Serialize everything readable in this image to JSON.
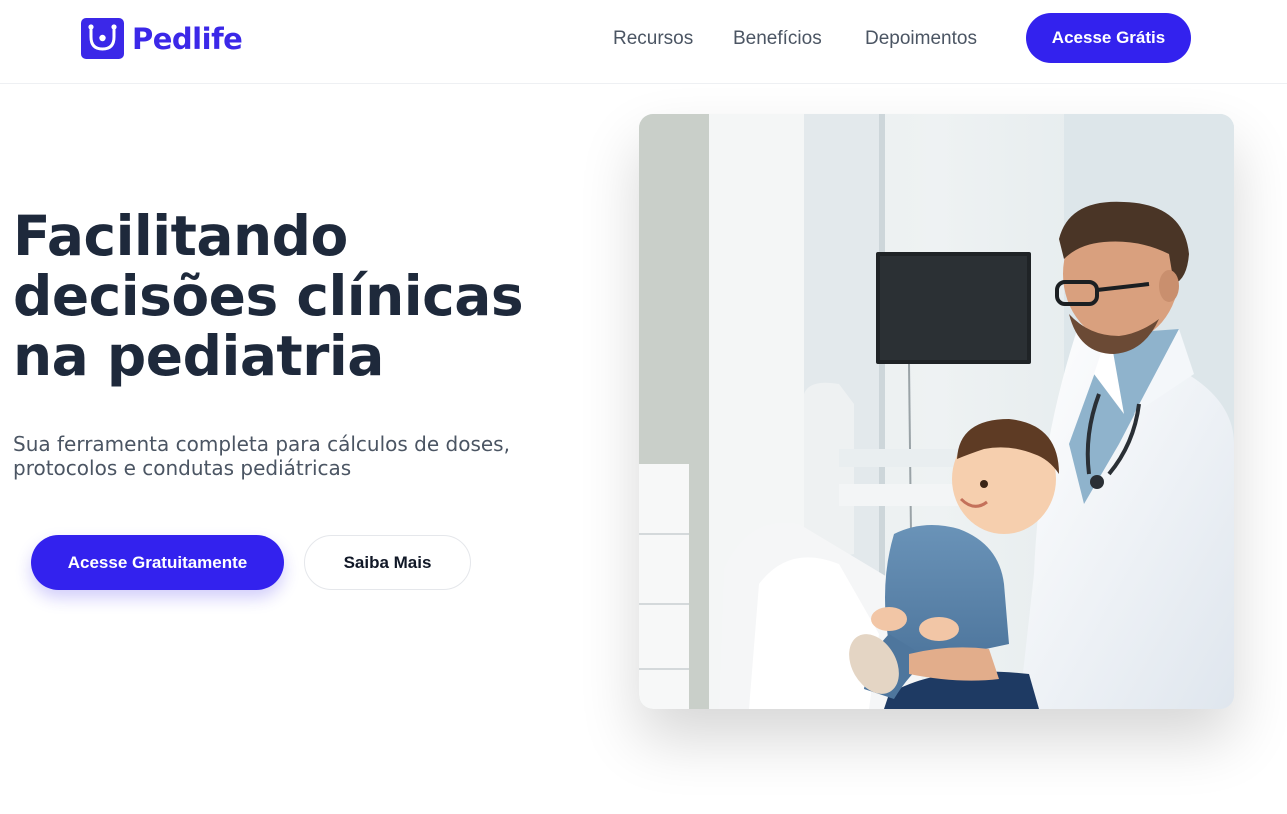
{
  "brand": {
    "name": "Pedlife",
    "color": "#3b28e8"
  },
  "nav": {
    "links": [
      "Recursos",
      "Benefícios",
      "Depoimentos"
    ],
    "cta": "Acesse Grátis"
  },
  "hero": {
    "title_lines": [
      "Facilitando",
      "decisões clínicas",
      "na pediatria"
    ],
    "subtitle_lines": [
      "Sua ferramenta completa para cálculos de doses,",
      "protocolos e condutas pediátricas"
    ],
    "primary_button": "Acesse Gratuitamente",
    "secondary_button": "Saiba Mais"
  },
  "image": {
    "icon": "doctor-with-child-photo"
  }
}
